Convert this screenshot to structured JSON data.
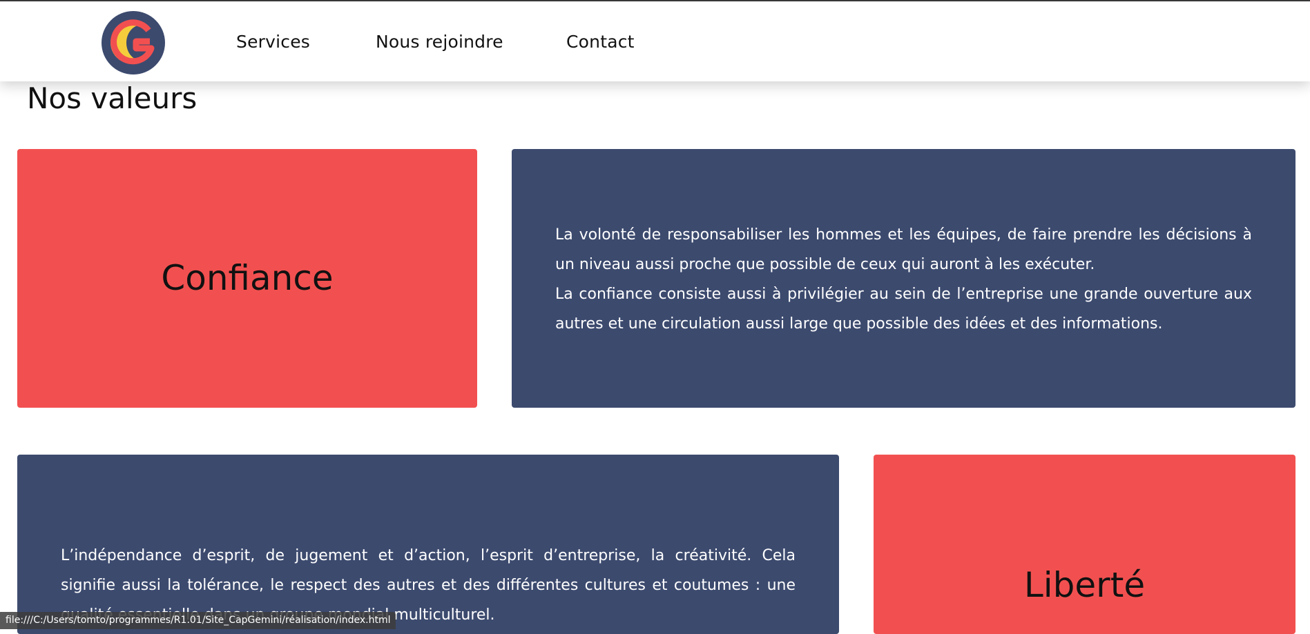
{
  "nav": {
    "items": [
      {
        "label": "Services"
      },
      {
        "label": "Nous rejoindre"
      },
      {
        "label": "Contact"
      }
    ]
  },
  "logo": {
    "letter": "G",
    "colors": {
      "ring": "#3c4a6e",
      "arc": "#f5cd3c",
      "letter": "#f25050"
    }
  },
  "page": {
    "title": "Nos valeurs"
  },
  "values": [
    {
      "title": "Confiance",
      "paragraphs": [
        "La volonté de responsabiliser les hommes et les équipes, de faire prendre les décisions à un niveau aussi proche que possible de ceux qui auront à les exécuter.",
        "La confiance consiste aussi à privilégier au sein de l’entreprise une grande ouverture aux autres et une circulation aussi large que possible des idées et des informations."
      ]
    },
    {
      "title": "Liberté",
      "paragraphs": [
        "L’indépendance d’esprit, de jugement et d’action, l’esprit d’entreprise, la créativité. Cela signifie aussi la tolérance, le respect des autres et des différentes cultures et coutumes : une qualité essentielle dans un groupe mondial multiculturel."
      ]
    }
  ],
  "colors": {
    "accent_red": "#f25050",
    "navy": "#3c4a6e"
  },
  "status_bar": {
    "url": "file:///C:/Users/tomto/programmes/R1.01/Site_CapGemini/réalisation/index.html"
  }
}
